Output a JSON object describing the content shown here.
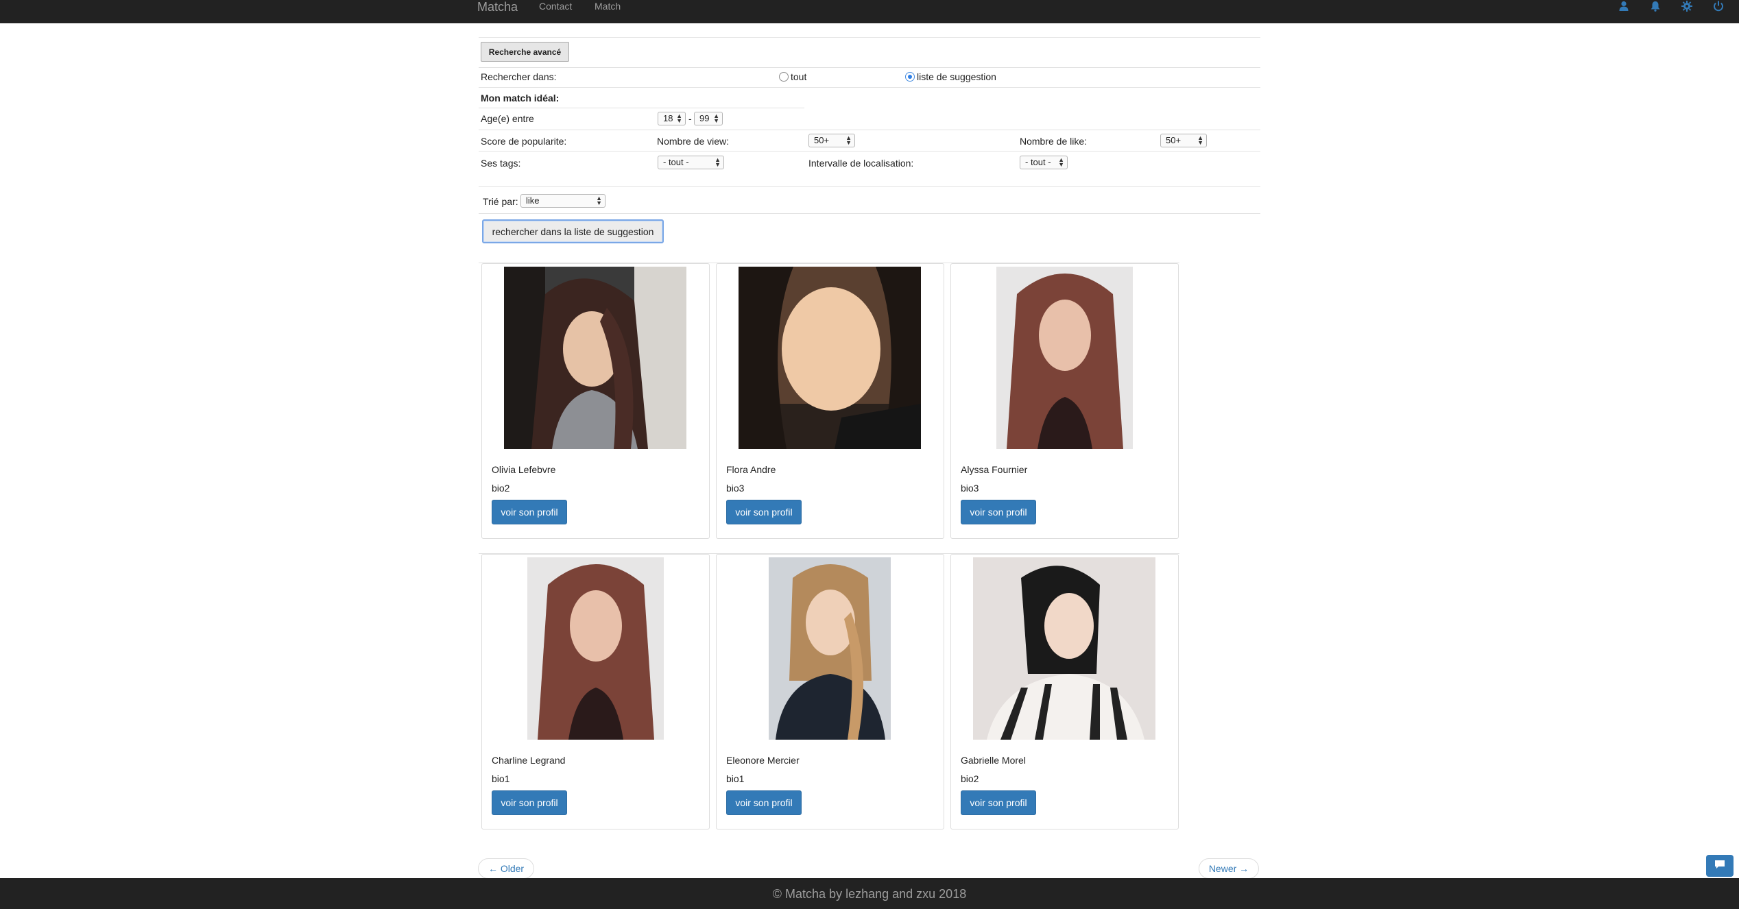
{
  "navbar": {
    "brand": "Matcha",
    "links": [
      "Contact",
      "Match"
    ],
    "icons": [
      "user-icon",
      "bell-icon",
      "gear-icon",
      "power-icon"
    ],
    "icon_color": "#337ab7"
  },
  "search": {
    "advanced_button": "Recherche avancé",
    "search_in_label": "Rechercher dans:",
    "scope_options": [
      {
        "label": "tout",
        "selected": false
      },
      {
        "label": "liste de suggestion",
        "selected": true
      }
    ],
    "ideal_match_label": "Mon match idéal:",
    "age_label": "Age(e) entre",
    "age_min": "18",
    "age_separator": "-",
    "age_max": "99",
    "popularity_label": "Score de popularite:",
    "views_label": "Nombre de view:",
    "views_value": "50+",
    "likes_label": "Nombre de like:",
    "likes_value": "50+",
    "tags_label": "Ses tags:",
    "tags_value": "- tout -",
    "location_label": "Intervalle de localisation:",
    "location_value": "- tout -",
    "sort_label": "Trié par:",
    "sort_value": "like",
    "submit_button": "rechercher dans la liste de suggestion"
  },
  "profiles": [
    {
      "name": "Olivia Lefebvre",
      "bio": "bio2",
      "button": "voir son profil"
    },
    {
      "name": "Flora Andre",
      "bio": "bio3",
      "button": "voir son profil"
    },
    {
      "name": "Alyssa Fournier",
      "bio": "bio3",
      "button": "voir son profil"
    },
    {
      "name": "Charline Legrand",
      "bio": "bio1",
      "button": "voir son profil"
    },
    {
      "name": "Eleonore Mercier",
      "bio": "bio1",
      "button": "voir son profil"
    },
    {
      "name": "Gabrielle Morel",
      "bio": "bio2",
      "button": "voir son profil"
    }
  ],
  "pager": {
    "older": "← Older",
    "newer": "Newer →"
  },
  "footer": {
    "text": "© Matcha by lezhang and zxu 2018"
  },
  "chat": {
    "icon": "chat-icon"
  },
  "colors": {
    "navbar_bg": "#222222",
    "primary": "#337ab7",
    "radio_selected": "#2f7fe6"
  }
}
